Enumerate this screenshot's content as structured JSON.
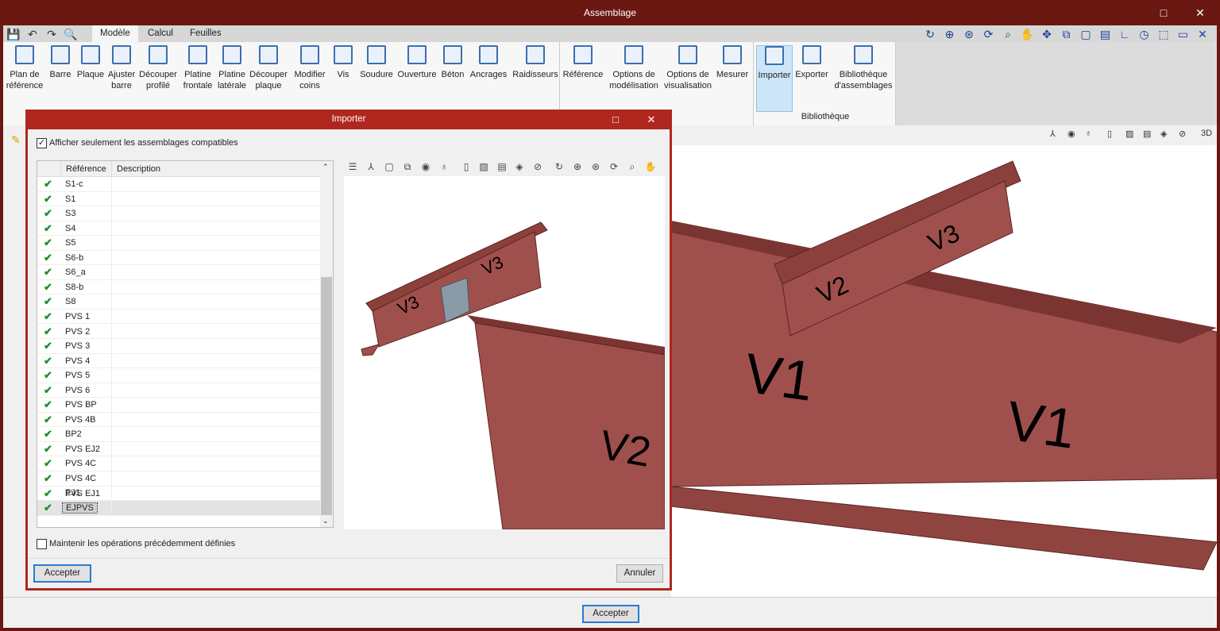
{
  "window": {
    "title": "Assemblage",
    "maximize": "□",
    "close": "✕"
  },
  "quick_access": [
    {
      "icon": "save-icon",
      "glyph": "💾"
    },
    {
      "icon": "undo-icon",
      "glyph": "↶"
    },
    {
      "icon": "redo-icon",
      "glyph": "↷"
    },
    {
      "icon": "search-icon",
      "glyph": "🔍"
    }
  ],
  "tabs": [
    {
      "label": "Modèle",
      "active": true
    },
    {
      "label": "Calcul"
    },
    {
      "label": "Feuilles"
    }
  ],
  "ribbon": {
    "items": [
      {
        "label": "Plan de\nréférence"
      },
      {
        "label": "Barre"
      },
      {
        "label": "Plaque"
      },
      {
        "label": "Ajuster\nbarre"
      },
      {
        "label": "Découper\nprofilé"
      },
      {
        "label": "Platine\nfrontale"
      },
      {
        "label": "Platine\nlatérale"
      },
      {
        "label": "Découper\nplaque"
      },
      {
        "label": "Modifier\ncoins"
      },
      {
        "label": "Vis"
      },
      {
        "label": "Soudure"
      },
      {
        "label": "Ouverture"
      },
      {
        "label": "Béton"
      },
      {
        "label": "Ancrages"
      },
      {
        "label": "Raidisseurs"
      },
      {
        "label": "Référence"
      },
      {
        "label": "Options de\nmodélisation"
      },
      {
        "label": "Options de\nvisualisation"
      },
      {
        "label": "Mesurer"
      },
      {
        "label": "Importer",
        "selected": true
      },
      {
        "label": "Exporter"
      },
      {
        "label": "Bibliothèque\nd'assemblages"
      }
    ],
    "group_label": "Bibliothèque"
  },
  "top_right_tools": [
    "rotate-icon",
    "zoom-window-icon",
    "zoom-x2-icon",
    "refresh-icon",
    "zoom-icon",
    "pan-hand-icon",
    "orbit-icon",
    "fit-icon",
    "frame-icon",
    "scale-icon",
    "angle-icon",
    "clock-icon",
    "selection-icon",
    "comment-icon",
    "tools-icon"
  ],
  "view_tools": [
    "axes-icon",
    "visibility-icon",
    "orbit-icon",
    "section-red-icon",
    "section-green-icon",
    "section-blue-icon",
    "cube-icon",
    "hide-icon",
    "3d-icon"
  ],
  "viewport": {
    "labels": [
      "V1",
      "V1",
      "V2",
      "V3"
    ]
  },
  "dialog": {
    "title": "Importer",
    "maximize": "□",
    "close": "✕",
    "show_compatible": {
      "label": "Afficher seulement les assemblages compatibles",
      "checked": true
    },
    "columns": [
      "Référence",
      "Description"
    ],
    "rows": [
      "S1-c",
      "S1",
      "S3",
      "S4",
      "S5",
      "S6-b",
      "S6_a",
      "S8-b",
      "S8",
      "PVS 1",
      "PVS 2",
      "PVS 3",
      "PVS 4",
      "PVS 5",
      "PVS 6",
      "PVS BP",
      "PVS 4B",
      "BP2",
      "PVS EJ2",
      "PVS 4C",
      "PVS 4C EJ1",
      "PVS EJ1",
      "EJPVS"
    ],
    "selected": "EJPVS",
    "preview_labels": [
      "V3",
      "V3",
      "V2"
    ],
    "keep_ops": {
      "label": "Maintenir les opérations précédemment définies",
      "checked": false
    },
    "accept": "Accepter",
    "cancel": "Annuler"
  },
  "bottom": {
    "accept": "Accepter"
  },
  "colors": {
    "title": "#6b1712",
    "dialog_title": "#b0271f",
    "steel": "#a0504c",
    "check": "#1f8f2a"
  }
}
